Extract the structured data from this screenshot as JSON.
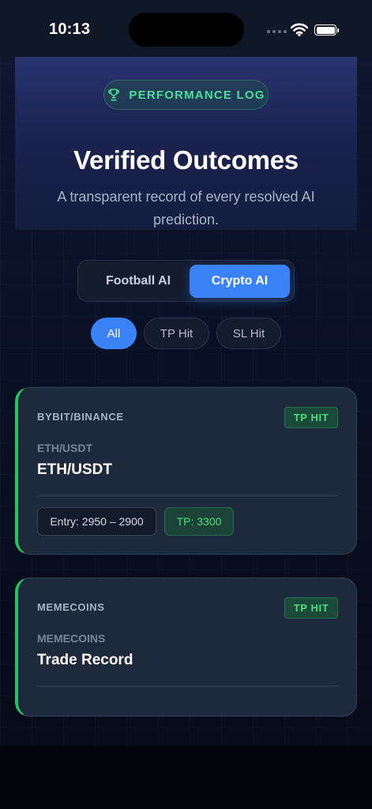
{
  "status_bar": {
    "time": "10:13",
    "icons": [
      "signal-icon",
      "wifi-icon",
      "battery-icon"
    ]
  },
  "hero": {
    "badge_label": "PERFORMANCE LOG",
    "badge_icon": "trophy-icon",
    "title": "Verified Outcomes",
    "subtitle": "A transparent record of every resolved AI prediction."
  },
  "tabs": [
    {
      "label": "Football AI",
      "active": false
    },
    {
      "label": "Crypto AI",
      "active": true
    }
  ],
  "filters": [
    {
      "label": "All",
      "active": true
    },
    {
      "label": "TP Hit",
      "active": false
    },
    {
      "label": "SL Hit",
      "active": false
    }
  ],
  "cards": [
    {
      "exchange": "BYBIT/BINANCE",
      "badge": "TP HIT",
      "pair_sub": "ETH/USDT",
      "pair": "ETH/USDT",
      "entry": "Entry: 2950 – 2900",
      "tp": "TP: 3300"
    },
    {
      "exchange": "MEMECOINS",
      "badge": "TP HIT",
      "pair_sub": "MEMECOINS",
      "pair": "Trade Record"
    }
  ],
  "colors": {
    "accent": "#3b82f6",
    "success": "#4ade80",
    "card_bg": "#1e293b",
    "page_bg": "#070b1a"
  }
}
